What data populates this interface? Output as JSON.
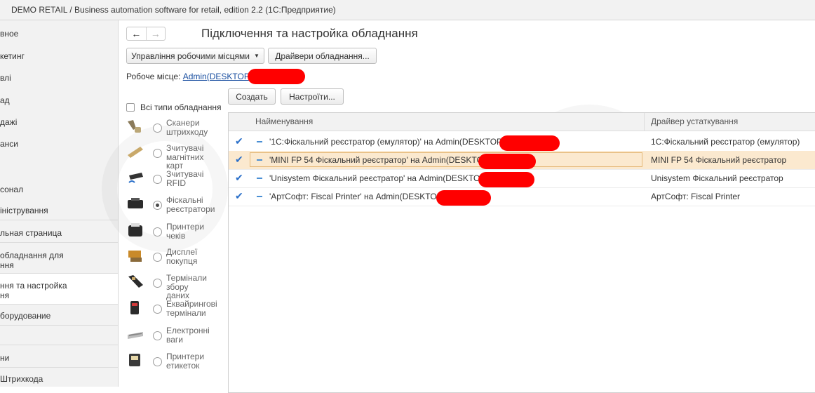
{
  "window": {
    "title": "DEMO RETAIL / Business automation software for retail, edition 2.2  (1С:Предприятие)"
  },
  "sidebar": {
    "items": [
      "вное",
      "кетинг",
      "влі",
      "ад",
      "дажі",
      "анси",
      "",
      "сонал",
      "іністрування",
      "льная страница",
      "обладнання для",
      "ння",
      "ння та настройка",
      "ня",
      "борудование",
      "ни",
      "Штрихкода"
    ]
  },
  "header": {
    "page_title": "Підключення та настройка обладнання",
    "back_icon": "arrow-left-icon",
    "forward_icon": "arrow-right-icon"
  },
  "toolbar": {
    "manage_workplaces": "Управління робочими місцями",
    "drivers": "Драйвери обладнання..."
  },
  "workplace": {
    "label": "Робоче місце:",
    "value": "Admin(DESKTOP"
  },
  "actions": {
    "create": "Создать",
    "settings": "Настроїти..."
  },
  "filter": {
    "all_types": "Всі типи обладнання",
    "types": [
      {
        "line1": "Сканери",
        "line2": "штрихкоду",
        "icon": "barcode-scanner-icon",
        "selected": false
      },
      {
        "line1": "Зчитувачі",
        "line2": "магнітних карт",
        "icon": "card-reader-icon",
        "selected": false
      },
      {
        "line1": "Зчитувачі",
        "line2": "RFID",
        "icon": "rfid-reader-icon",
        "selected": false
      },
      {
        "line1": "Фіскальні",
        "line2": "реєстратори",
        "icon": "fiscal-printer-icon",
        "selected": true
      },
      {
        "line1": "Принтери",
        "line2": "чеків",
        "icon": "receipt-printer-icon",
        "selected": false
      },
      {
        "line1": "Дисплеї",
        "line2": "покупця",
        "icon": "customer-display-icon",
        "selected": false
      },
      {
        "line1": "Термінали",
        "line2": "збору даних",
        "icon": "data-terminal-icon",
        "selected": false
      },
      {
        "line1": "Еквайрингові",
        "line2": "термінали",
        "icon": "acquiring-terminal-icon",
        "selected": false
      },
      {
        "line1": "Електронні",
        "line2": "ваги",
        "icon": "scales-icon",
        "selected": false
      },
      {
        "line1": "Принтери",
        "line2": "етикеток",
        "icon": "label-printer-icon",
        "selected": false
      }
    ]
  },
  "table": {
    "columns": [
      "Найменування",
      "Драйвер устаткування"
    ],
    "rows": [
      {
        "name": "'1С:Фіскальний реєстратор (емулятор)' на Admin(DESKTOP-",
        "driver": "1С:Фіскальний реєстратор (емулятор)",
        "selected": false
      },
      {
        "name": "'MINI FP 54 Фіскальний реєстратор' на Admin(DESKTOP",
        "driver": "MINI FP 54 Фіскальний реєстратор",
        "selected": true
      },
      {
        "name": "'Unisystem Фіскальний реєстратор' на Admin(DESKTOP",
        "driver": "Unisystem Фіскальний реєстратор",
        "selected": false
      },
      {
        "name": "'АртСофт: Fiscal Printer' на Admin(DESKTOP",
        "driver": "АртСофт: Fiscal Printer",
        "selected": false
      }
    ]
  },
  "colors": {
    "link": "#1a4fa0",
    "selected_row": "#fbe9cf",
    "redaction": "#ff0000",
    "check": "#2a6fc9"
  }
}
